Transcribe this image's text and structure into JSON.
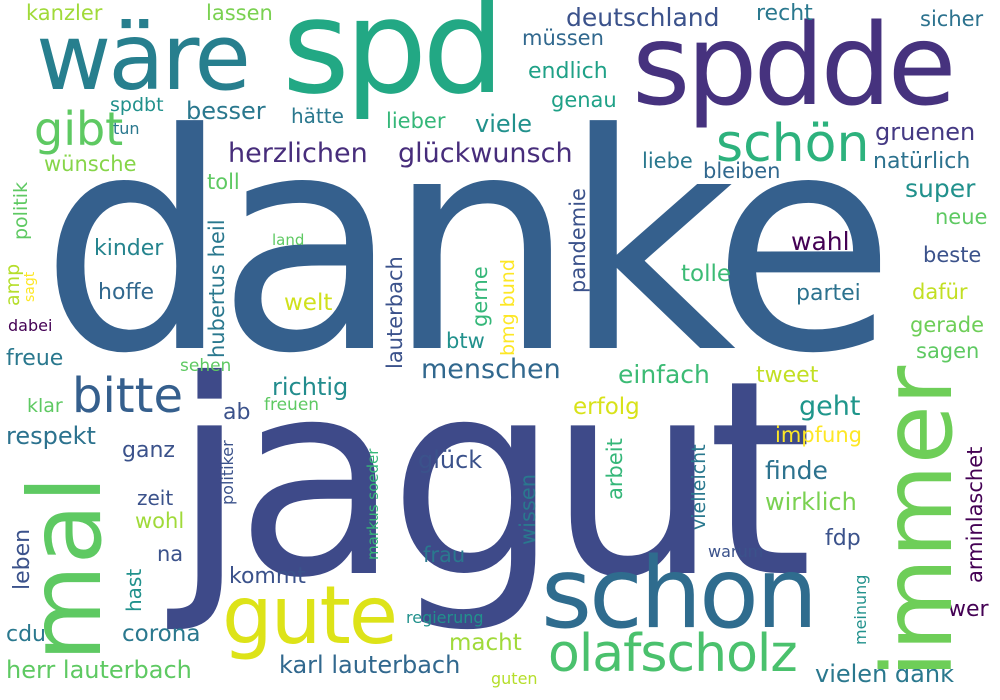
{
  "colors": {
    "background": "#ffffff",
    "palette": [
      "#440154",
      "#3b528b",
      "#21918c",
      "#5ec962",
      "#fde725"
    ]
  },
  "words": {
    "danke": "danke",
    "jagut": "jagut",
    "spd": "spd",
    "spdde": "spdde",
    "ware": "wäre",
    "schon": "schon",
    "mal": "mal",
    "immer": "immer",
    "gute": "gute",
    "olafscholz": "olafscholz",
    "bitte": "bitte",
    "schoen": "schön",
    "gibt": "gibt",
    "herzlichen": "herzlichen",
    "gluckwunsch": "glückwunsch",
    "deutschland": "deutschland",
    "menschen": "menschen",
    "karl_lauterbach": "karl lauterbach",
    "herr_lauterbach": "herr lauterbach",
    "vielen_dank": "vielen dank",
    "gruenen": "gruenen",
    "super": "super",
    "geht": "geht",
    "finde": "finde",
    "wirklich": "wirklich",
    "wahl": "wahl",
    "partei": "partei",
    "einfach": "einfach",
    "tweet": "tweet",
    "erfolg": "erfolg",
    "impfung": "impfung",
    "richtig": "richtig",
    "respekt": "respekt",
    "besser": "besser",
    "hatte": "hätte",
    "lieber": "lieber",
    "viele": "viele",
    "mussen": "müssen",
    "endlich": "endlich",
    "genau": "genau",
    "recht": "recht",
    "sicher": "sicher",
    "kanzler": "kanzler",
    "lassen": "lassen",
    "spdbt": "spdbt",
    "tun": "tun",
    "wunsche": "wünsche",
    "liebe": "liebe",
    "bleiben": "bleiben",
    "naturlich": "natürlich",
    "neue": "neue",
    "beste": "beste",
    "dafur": "dafür",
    "gerade": "gerade",
    "sagen": "sagen",
    "kinder": "kinder",
    "hoffe": "hoffe",
    "toll": "toll",
    "land": "land",
    "tolle": "tolle",
    "welt": "welt",
    "btw": "btw",
    "freue": "freue",
    "dabei": "dabei",
    "sehen": "sehen",
    "freuen": "freuen",
    "ab": "ab",
    "klar": "klar",
    "ganz": "ganz",
    "zeit": "zeit",
    "wohl": "wohl",
    "na": "na",
    "gluck": "glück",
    "frau": "frau",
    "kommt": "kommt",
    "cdu": "cdu",
    "corona": "corona",
    "macht": "macht",
    "regierung": "regierung",
    "guten": "guten",
    "warum": "warum",
    "fdp": "fdp",
    "wer": "wer",
    "politik": "politik",
    "amp": "amp",
    "sagt": "sagt",
    "hubertus_heil": "hubertus heil",
    "lauterbach": "lauterbach",
    "gerne": "gerne",
    "bmg_bund": "bmg bund",
    "pandemie": "pandemie",
    "arbeit": "arbeit",
    "politiker": "politiker",
    "markus_soeder": "markus soeder",
    "wissen": "wissen",
    "vielleicht": "vielleicht",
    "arminlaschet": "arminlaschet",
    "meinung": "meinung",
    "leben": "leben",
    "hast": "hast"
  }
}
